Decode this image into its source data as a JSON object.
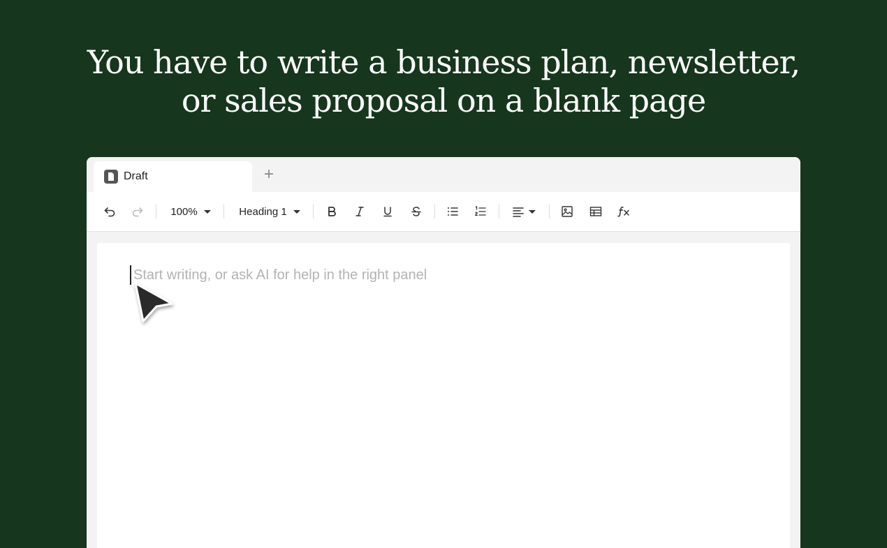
{
  "headline": {
    "line1": "You have to write a business plan, newsletter,",
    "line2": "or sales proposal on a blank page"
  },
  "tabs": {
    "active_label": "Draft",
    "add_label": "+"
  },
  "toolbar": {
    "zoom": "100%",
    "style": "Heading 1"
  },
  "editor": {
    "placeholder": "Start writing, or ask AI for help in the right panel"
  },
  "icons": {
    "undo": "undo-icon",
    "redo": "redo-icon",
    "bold": "bold-icon",
    "italic": "italic-icon",
    "underline": "underline-icon",
    "strikethrough": "strikethrough-icon",
    "bullet_list": "bullet-list-icon",
    "numbered_list": "numbered-list-icon",
    "align": "align-left-icon",
    "image": "image-icon",
    "table": "table-icon",
    "formula": "formula-icon",
    "document": "document-icon",
    "pointer": "mouse-pointer-icon"
  },
  "colors": {
    "background": "#16361d",
    "window": "#f3f3f3",
    "page": "#ffffff",
    "placeholder": "#b3b3b3"
  }
}
